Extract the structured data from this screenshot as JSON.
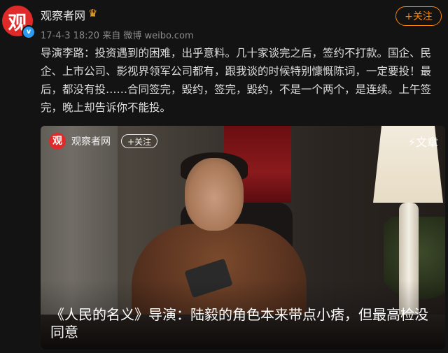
{
  "account": {
    "avatar_glyph": "观",
    "verified_glyph": "v",
    "name": "观察者网",
    "crown_icon": "♛",
    "meta": "17-4-3 18:20   来自 微博 weibo.com"
  },
  "follow_button": "+关注",
  "post_text": "导演李路：投资遇到的困难，出乎意料。几十家谈完之后，签约不打款。国企、民企、上市公司、影视界领军公司都有，跟我谈的时候特别慷慨陈词，一定要投！最后，都没有投……合同签完，毁约，签完，毁约，不是一个两个，是连续。上午签完，晚上却告诉你不能投。",
  "card": {
    "logo_glyph": "观",
    "source_name": "观察者网",
    "follow_label": "+关注",
    "badge": "⚡文章",
    "title": "《人民的名义》导演：陆毅的角色本来带点小痞，但最高检没同意"
  },
  "colors": {
    "background": "#131313",
    "accent": "#ff8200",
    "brand_red": "#e02a2a",
    "verified_blue": "#2d9cf0"
  }
}
